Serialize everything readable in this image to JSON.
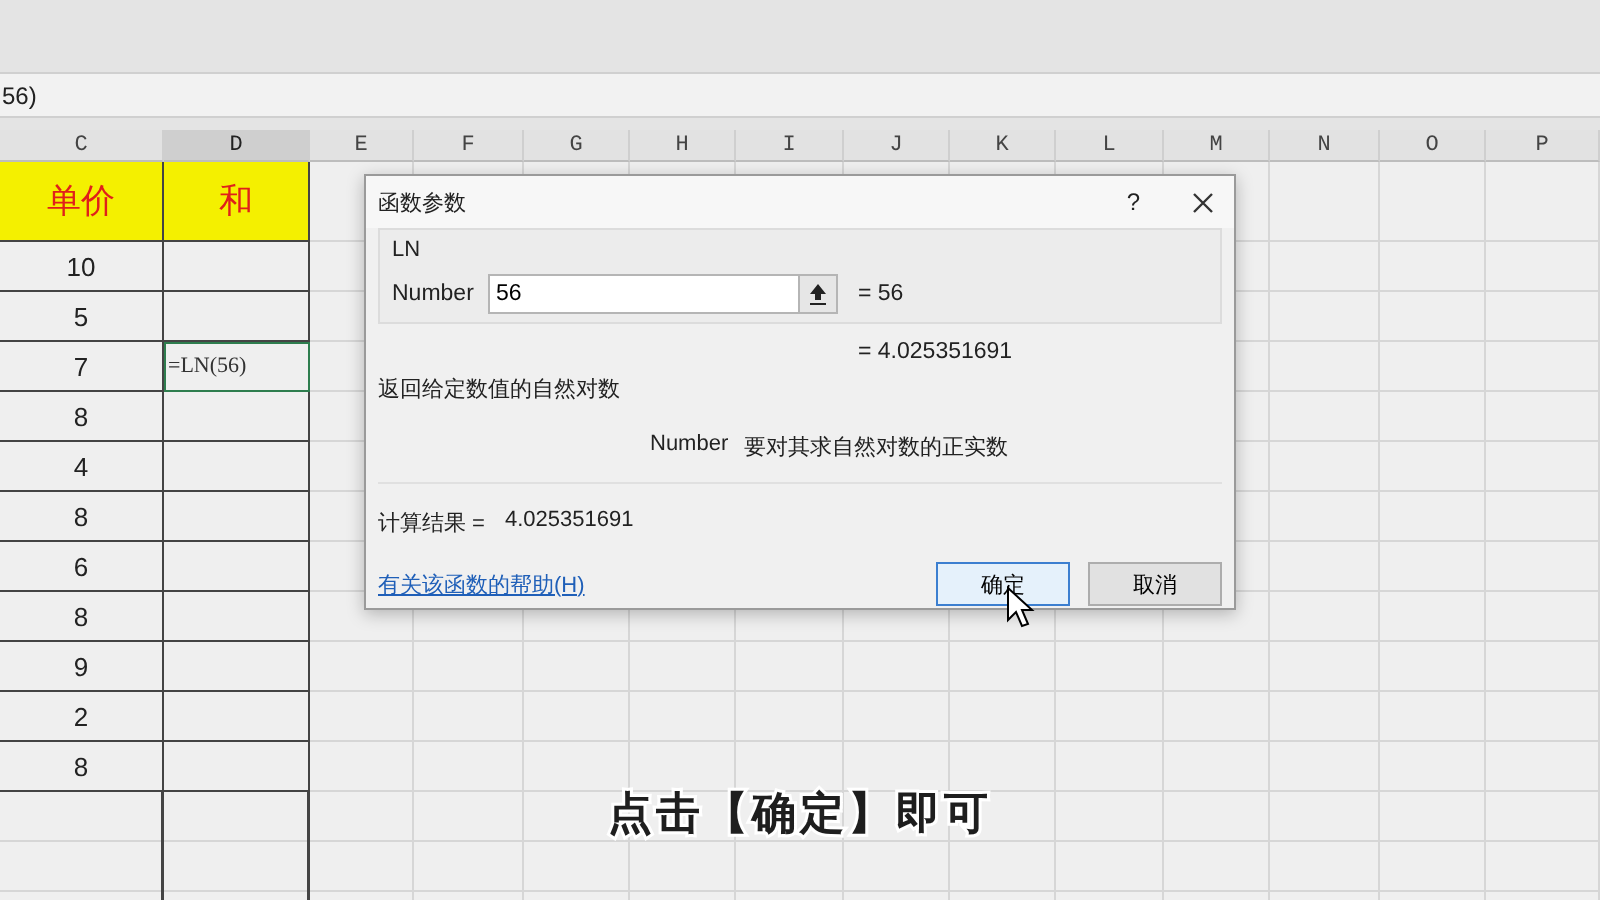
{
  "formula_bar": {
    "text": "56)"
  },
  "columns": [
    {
      "label": "C",
      "selected": false
    },
    {
      "label": "D",
      "selected": true
    },
    {
      "label": "E",
      "selected": false
    },
    {
      "label": "F",
      "selected": false
    },
    {
      "label": "G",
      "selected": false
    },
    {
      "label": "H",
      "selected": false
    },
    {
      "label": "I",
      "selected": false
    },
    {
      "label": "J",
      "selected": false
    },
    {
      "label": "K",
      "selected": false
    },
    {
      "label": "L",
      "selected": false
    },
    {
      "label": "M",
      "selected": false
    },
    {
      "label": "N",
      "selected": false
    },
    {
      "label": "O",
      "selected": false
    },
    {
      "label": "P",
      "selected": false
    }
  ],
  "header_cells": [
    "单价",
    "和"
  ],
  "rows": [
    {
      "price": "10",
      "selected": false
    },
    {
      "price": "5",
      "selected": false
    },
    {
      "price": "7",
      "formula": "=LN(56)",
      "selected": true
    },
    {
      "price": "8",
      "selected": false
    },
    {
      "price": "4",
      "selected": false
    },
    {
      "price": "8",
      "selected": false
    },
    {
      "price": "6",
      "selected": false
    },
    {
      "price": "8",
      "selected": false
    },
    {
      "price": "9",
      "selected": false
    },
    {
      "price": "2",
      "selected": false
    },
    {
      "price": "8",
      "selected": false
    }
  ],
  "dialog": {
    "title": "函数参数",
    "help": "?",
    "function_name": "LN",
    "argument": {
      "label": "Number",
      "value": "56"
    },
    "argument_result": "=  56",
    "result": "=  4.025351691",
    "description": "返回给定数值的自然对数",
    "argument_description": {
      "name": "Number",
      "text": "要对其求自然对数的正实数"
    },
    "formula_result_label": "计算结果 =",
    "formula_result": "4.025351691",
    "help_link": "有关该函数的帮助(H)",
    "buttons": [
      {
        "label": "确定",
        "default": true
      },
      {
        "label": "取消",
        "default": false
      }
    ]
  },
  "subtitle": "点击【确定】即可"
}
